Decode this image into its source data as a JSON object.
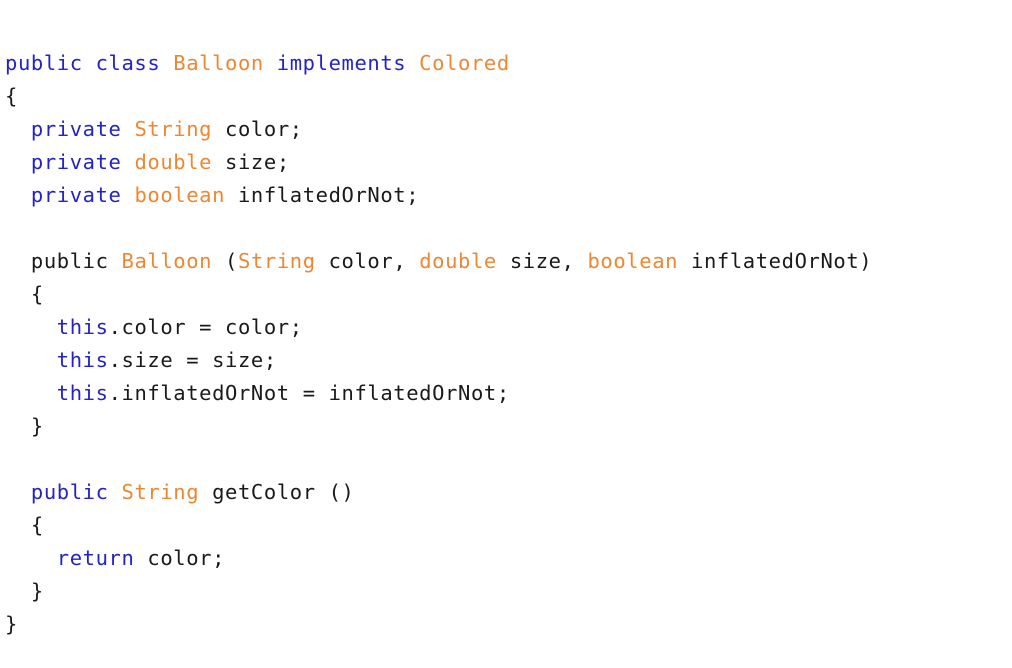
{
  "colors": {
    "keyword": "#2323c8",
    "type_or_name": "#ee8733",
    "plain": "#1a1a1a",
    "background": "#ffffff"
  },
  "code": {
    "lines": [
      {
        "tokens": [
          {
            "t": "kw",
            "v": "public class "
          },
          {
            "t": "ty",
            "v": "Balloon "
          },
          {
            "t": "kw",
            "v": "implements "
          },
          {
            "t": "ty",
            "v": "Colored"
          }
        ]
      },
      {
        "tokens": [
          {
            "t": "tx",
            "v": "{"
          }
        ]
      },
      {
        "tokens": [
          {
            "t": "tx",
            "v": "  "
          },
          {
            "t": "kw",
            "v": "private "
          },
          {
            "t": "ty",
            "v": "String "
          },
          {
            "t": "tx",
            "v": "color;"
          }
        ]
      },
      {
        "tokens": [
          {
            "t": "tx",
            "v": "  "
          },
          {
            "t": "kw",
            "v": "private "
          },
          {
            "t": "ty",
            "v": "double "
          },
          {
            "t": "tx",
            "v": "size;"
          }
        ]
      },
      {
        "tokens": [
          {
            "t": "tx",
            "v": "  "
          },
          {
            "t": "kw",
            "v": "private "
          },
          {
            "t": "ty",
            "v": "boolean "
          },
          {
            "t": "tx",
            "v": "inflatedOrNot;"
          }
        ]
      },
      {
        "tokens": []
      },
      {
        "tokens": [
          {
            "t": "tx",
            "v": "  "
          },
          {
            "t": "tx",
            "v": "public "
          },
          {
            "t": "ty",
            "v": "Balloon "
          },
          {
            "t": "tx",
            "v": "("
          },
          {
            "t": "ty",
            "v": "String "
          },
          {
            "t": "tx",
            "v": "color, "
          },
          {
            "t": "ty",
            "v": "double "
          },
          {
            "t": "tx",
            "v": "size, "
          },
          {
            "t": "ty",
            "v": "boolean "
          },
          {
            "t": "tx",
            "v": "inflatedOrNot)"
          }
        ]
      },
      {
        "tokens": [
          {
            "t": "tx",
            "v": "  {"
          }
        ]
      },
      {
        "tokens": [
          {
            "t": "tx",
            "v": "    "
          },
          {
            "t": "kw",
            "v": "this"
          },
          {
            "t": "tx",
            "v": ".color = color;"
          }
        ]
      },
      {
        "tokens": [
          {
            "t": "tx",
            "v": "    "
          },
          {
            "t": "kw",
            "v": "this"
          },
          {
            "t": "tx",
            "v": ".size = size;"
          }
        ]
      },
      {
        "tokens": [
          {
            "t": "tx",
            "v": "    "
          },
          {
            "t": "kw",
            "v": "this"
          },
          {
            "t": "tx",
            "v": ".inflatedOrNot = inflatedOrNot;"
          }
        ]
      },
      {
        "tokens": [
          {
            "t": "tx",
            "v": "  }"
          }
        ]
      },
      {
        "tokens": []
      },
      {
        "tokens": [
          {
            "t": "tx",
            "v": "  "
          },
          {
            "t": "kw",
            "v": "public "
          },
          {
            "t": "ty",
            "v": "String "
          },
          {
            "t": "tx",
            "v": "getColor ()"
          }
        ]
      },
      {
        "tokens": [
          {
            "t": "tx",
            "v": "  {"
          }
        ]
      },
      {
        "tokens": [
          {
            "t": "tx",
            "v": "    "
          },
          {
            "t": "kw",
            "v": "return "
          },
          {
            "t": "tx",
            "v": "color;"
          }
        ]
      },
      {
        "tokens": [
          {
            "t": "tx",
            "v": "  }"
          }
        ]
      },
      {
        "tokens": [
          {
            "t": "tx",
            "v": "}"
          }
        ]
      }
    ]
  }
}
